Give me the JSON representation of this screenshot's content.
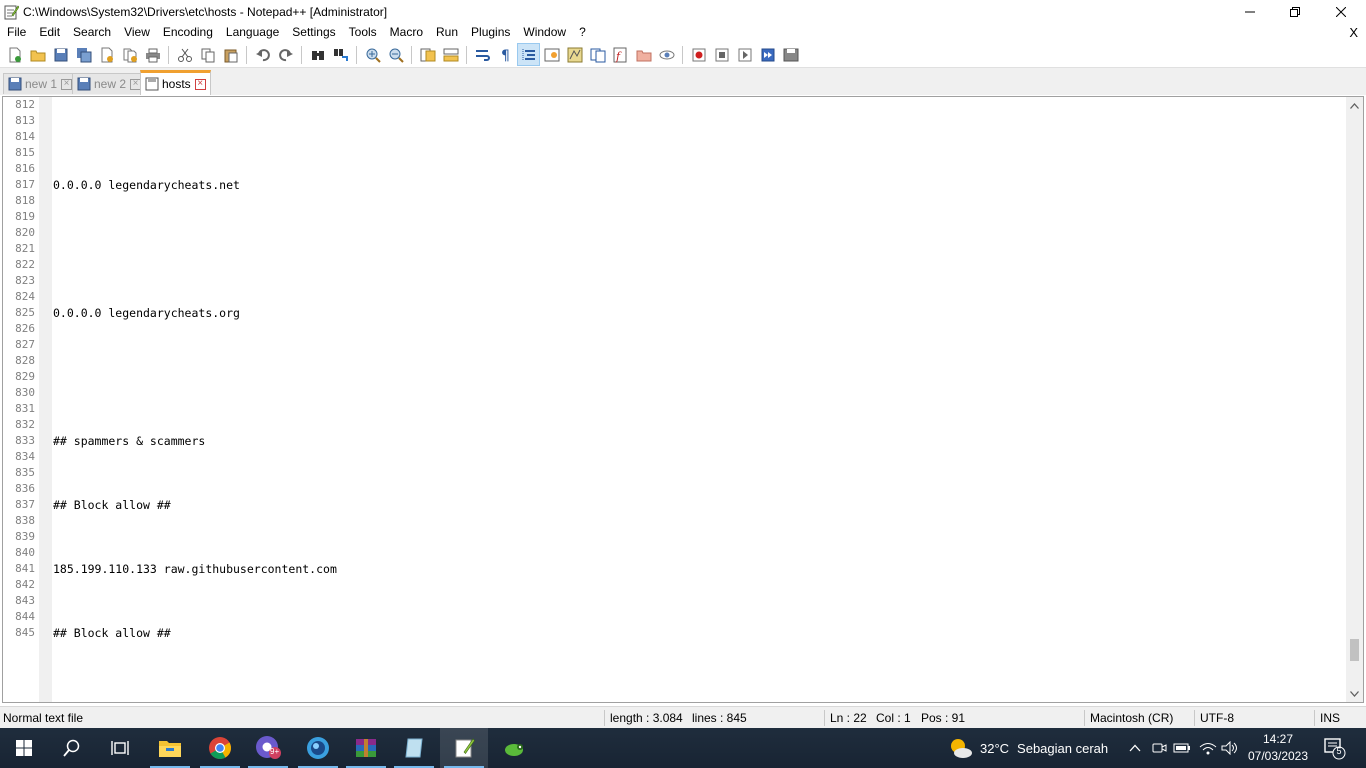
{
  "window": {
    "title": "C:\\Windows\\System32\\Drivers\\etc\\hosts - Notepad++ [Administrator]"
  },
  "menu": {
    "items": [
      "File",
      "Edit",
      "Search",
      "View",
      "Encoding",
      "Language",
      "Settings",
      "Tools",
      "Macro",
      "Run",
      "Plugins",
      "Window",
      "?"
    ],
    "close_x": "X"
  },
  "tabs": [
    {
      "label": "new 1",
      "active": false
    },
    {
      "label": "new 2",
      "active": false
    },
    {
      "label": "hosts",
      "active": true
    }
  ],
  "editor": {
    "lines": [
      {
        "n": "812",
        "text": ""
      },
      {
        "n": "813",
        "text": ""
      },
      {
        "n": "814",
        "text": ""
      },
      {
        "n": "815",
        "text": ""
      },
      {
        "n": "816",
        "text": ""
      },
      {
        "n": "817",
        "text": "0.0.0.0 legendarycheats.net"
      },
      {
        "n": "818",
        "text": ""
      },
      {
        "n": "819",
        "text": ""
      },
      {
        "n": "820",
        "text": ""
      },
      {
        "n": "821",
        "text": ""
      },
      {
        "n": "822",
        "text": ""
      },
      {
        "n": "823",
        "text": ""
      },
      {
        "n": "824",
        "text": ""
      },
      {
        "n": "825",
        "text": "0.0.0.0 legendarycheats.org"
      },
      {
        "n": "826",
        "text": ""
      },
      {
        "n": "827",
        "text": ""
      },
      {
        "n": "828",
        "text": ""
      },
      {
        "n": "829",
        "text": ""
      },
      {
        "n": "830",
        "text": ""
      },
      {
        "n": "831",
        "text": ""
      },
      {
        "n": "832",
        "text": ""
      },
      {
        "n": "833",
        "text": "## spammers & scammers"
      },
      {
        "n": "834",
        "text": ""
      },
      {
        "n": "835",
        "text": ""
      },
      {
        "n": "836",
        "text": ""
      },
      {
        "n": "837",
        "text": "## Block allow ##"
      },
      {
        "n": "838",
        "text": ""
      },
      {
        "n": "839",
        "text": ""
      },
      {
        "n": "840",
        "text": ""
      },
      {
        "n": "841",
        "text": "185.199.110.133 raw.githubusercontent.com"
      },
      {
        "n": "842",
        "text": ""
      },
      {
        "n": "843",
        "text": ""
      },
      {
        "n": "844",
        "text": ""
      },
      {
        "n": "845",
        "text": "## Block allow ##"
      }
    ]
  },
  "status": {
    "file_type": "Normal text file",
    "length": "length : 3.084",
    "lines": "lines : 845",
    "ln": "Ln : 22",
    "col": "Col : 1",
    "pos": "Pos : 91",
    "eol": "Macintosh (CR)",
    "encoding": "UTF-8",
    "mode": "INS"
  },
  "taskbar": {
    "weather_temp": "32°C",
    "weather_condition": "Sebagian cerah",
    "chrome_badge": "9+",
    "time": "14:27",
    "date": "07/03/2023",
    "notification_count": "5"
  },
  "colors": {
    "tab_accent": "#f0a030",
    "taskbar_bg": "#1c2a3a",
    "taskbar_running": "#76b9ed"
  }
}
